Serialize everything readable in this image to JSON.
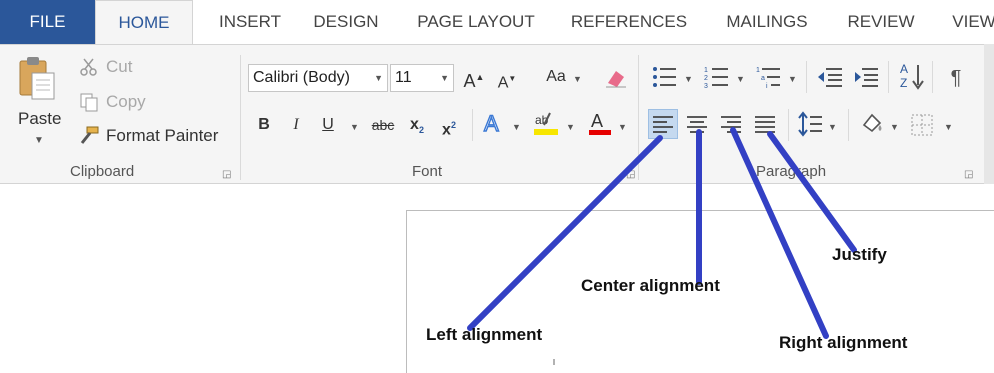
{
  "tabs": {
    "file": "FILE",
    "home": "HOME",
    "insert": "INSERT",
    "design": "DESIGN",
    "page_layout": "PAGE LAYOUT",
    "references": "REFERENCES",
    "mailings": "MAILINGS",
    "review": "REVIEW",
    "view": "VIEW"
  },
  "clipboard": {
    "paste": "Paste",
    "cut": "Cut",
    "copy": "Copy",
    "format_painter": "Format Painter",
    "label": "Clipboard"
  },
  "font": {
    "name": "Calibri (Body)",
    "size": "11",
    "change_case": "Aa",
    "bold": "B",
    "italic": "I",
    "underline": "U",
    "strikethrough": "abc",
    "subscript_base": "x",
    "subscript_mark": "2",
    "superscript_base": "x",
    "superscript_mark": "2",
    "font_color_letter": "A",
    "label": "Font",
    "highlight_color": "#f7e600",
    "font_color": "#e60000"
  },
  "paragraph": {
    "label": "Paragraph",
    "sort_a": "A",
    "sort_z": "Z",
    "pilcrow": "¶"
  },
  "annotations": {
    "left": "Left alignment",
    "center": "Center alignment",
    "right": "Right alignment",
    "justify": "Justify",
    "color": "#3340c4"
  }
}
